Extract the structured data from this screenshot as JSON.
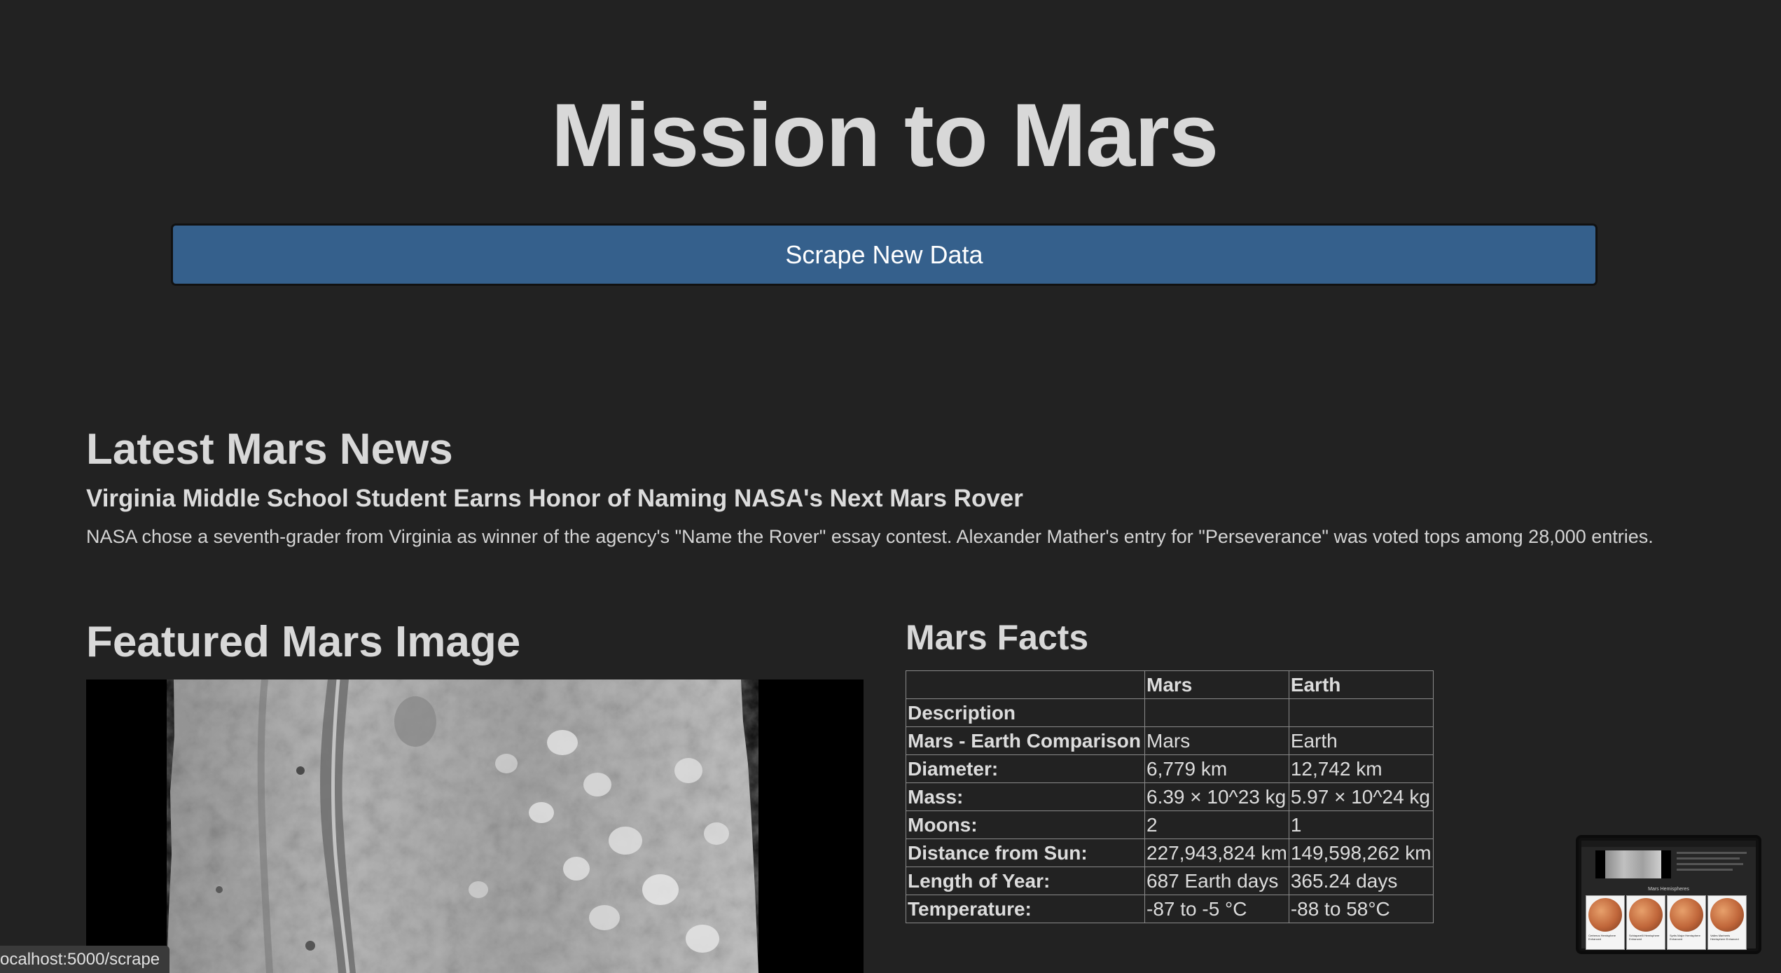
{
  "page": {
    "title": "Mission to Mars",
    "scrape_button_label": "Scrape New Data"
  },
  "news": {
    "heading": "Latest Mars News",
    "title": "Virginia Middle School Student Earns Honor of Naming NASA's Next Mars Rover",
    "paragraph": "NASA chose a seventh-grader from Virginia as winner of the agency's \"Name the Rover\" essay contest. Alexander Mather's entry for \"Perseverance\" was voted tops among 28,000 entries."
  },
  "featured_image": {
    "heading": "Featured Mars Image"
  },
  "facts": {
    "heading": "Mars Facts",
    "columns": [
      "",
      "Mars",
      "Earth"
    ],
    "rows": [
      [
        "Description",
        "",
        ""
      ],
      [
        "Mars - Earth Comparison",
        "Mars",
        "Earth"
      ],
      [
        "Diameter:",
        "6,779 km",
        "12,742 km"
      ],
      [
        "Mass:",
        "6.39 × 10^23 kg",
        "5.97 × 10^24 kg"
      ],
      [
        "Moons:",
        "2",
        "1"
      ],
      [
        "Distance from Sun:",
        "227,943,824 km",
        "149,598,262 km"
      ],
      [
        "Length of Year:",
        "687 Earth days",
        "365.24 days"
      ],
      [
        "Temperature:",
        "-87 to -5 °C",
        "-88 to 58°C"
      ]
    ]
  },
  "status_bar": {
    "url": "ocalhost:5000/scrape"
  },
  "preview_thumbnail": {
    "label": "Mars Hemispheres",
    "cards": [
      "Cerberus Hemisphere Enhanced",
      "Schiaparelli Hemisphere Enhanced",
      "Syrtis Major Hemisphere Enhanced",
      "Valles Marineris Hemisphere Enhanced"
    ]
  }
}
